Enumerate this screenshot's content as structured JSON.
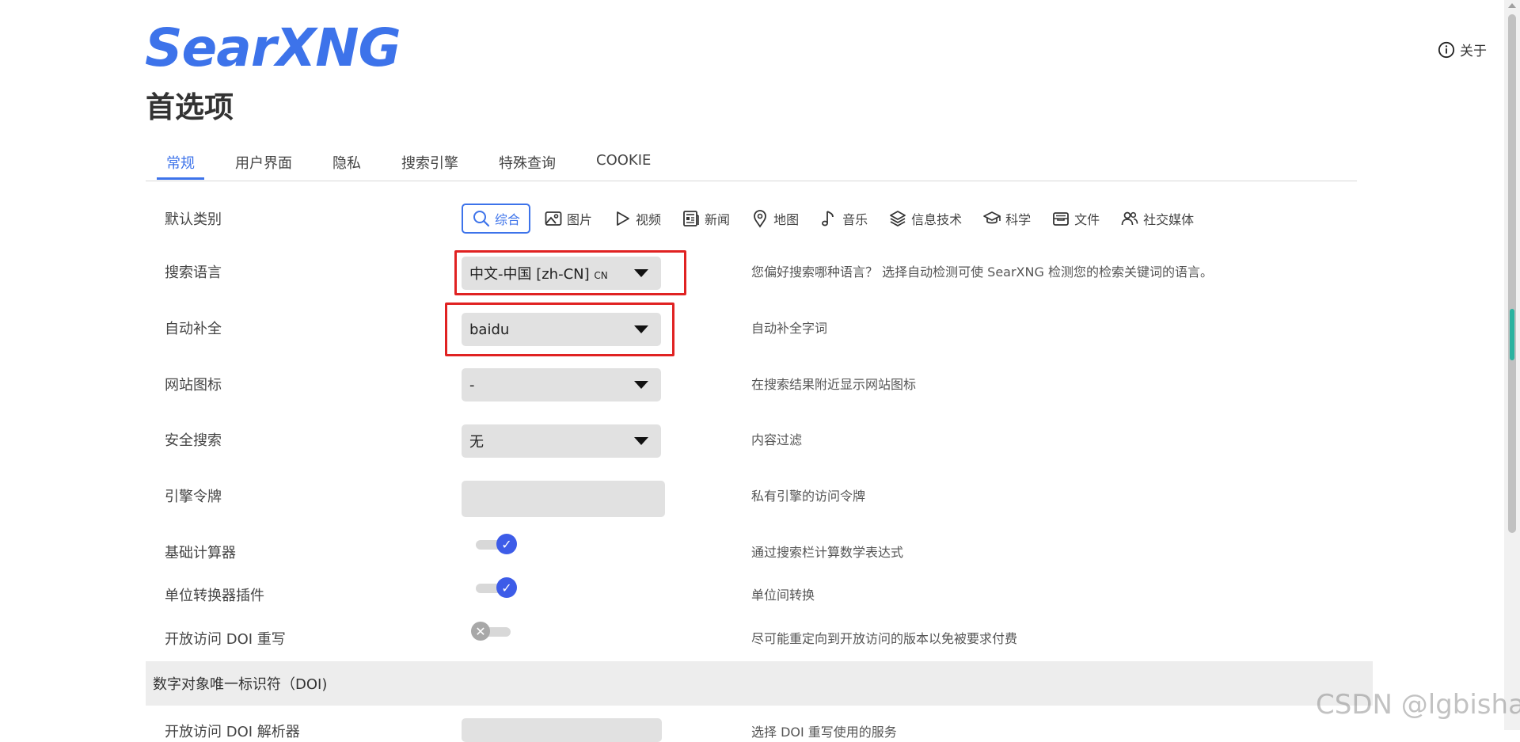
{
  "header": {
    "logo": "SearXNG",
    "about_label": "关于",
    "page_title": "首选项"
  },
  "tabs": [
    {
      "label": "常规",
      "active": true
    },
    {
      "label": "用户界面"
    },
    {
      "label": "隐私"
    },
    {
      "label": "搜索引擎"
    },
    {
      "label": "特殊查询"
    },
    {
      "label": "COOKIE"
    }
  ],
  "rows": {
    "default_category": {
      "label": "默认类别",
      "categories": [
        {
          "label": "综合",
          "icon": "search-icon",
          "selected": true
        },
        {
          "label": "图片",
          "icon": "image-icon"
        },
        {
          "label": "视频",
          "icon": "play-icon"
        },
        {
          "label": "新闻",
          "icon": "newspaper-icon"
        },
        {
          "label": "地图",
          "icon": "map-pin-icon"
        },
        {
          "label": "音乐",
          "icon": "music-note-icon"
        },
        {
          "label": "信息技术",
          "icon": "layers-icon"
        },
        {
          "label": "科学",
          "icon": "graduation-cap-icon"
        },
        {
          "label": "文件",
          "icon": "file-tray-icon"
        },
        {
          "label": "社交媒体",
          "icon": "people-icon"
        }
      ]
    },
    "search_language": {
      "label": "搜索语言",
      "value": "中文-中国 [zh-CN]",
      "value_suffix": "CN",
      "help": "您偏好搜索哪种语言？ 选择自动检测可使 SearXNG 检测您的检索关键词的语言。"
    },
    "autocomplete": {
      "label": "自动补全",
      "value": "baidu",
      "help": "自动补全字词"
    },
    "favicon": {
      "label": "网站图标",
      "value": "-",
      "help": "在搜索结果附近显示网站图标"
    },
    "safe_search": {
      "label": "安全搜索",
      "value": "无",
      "help": "内容过滤"
    },
    "engine_tokens": {
      "label": "引擎令牌",
      "value": "",
      "help": "私有引擎的访问令牌"
    },
    "basic_calculator": {
      "label": "基础计算器",
      "enabled": true,
      "help": "通过搜索栏计算数学表达式"
    },
    "unit_converter": {
      "label": "单位转换器插件",
      "enabled": true,
      "help": "单位间转换"
    },
    "open_access_doi": {
      "label": "开放访问 DOI 重写",
      "enabled": false,
      "help": "尽可能重定向到开放访问的版本以免被要求付费"
    }
  },
  "doi_section": {
    "title": "数字对象唯一标识符（DOI)",
    "next_label": "开放访问 DOI 解析器",
    "next_help": "选择 DOI 重写使用的服务"
  },
  "toggle_glyphs": {
    "on": "✓",
    "off": "✕"
  },
  "watermark": "CSDN @lgbisha",
  "colors": {
    "accent": "#3d73ea",
    "highlight_box": "#e02222",
    "toggle_on": "#3d5ce8",
    "field_bg": "#e1e1e1"
  }
}
